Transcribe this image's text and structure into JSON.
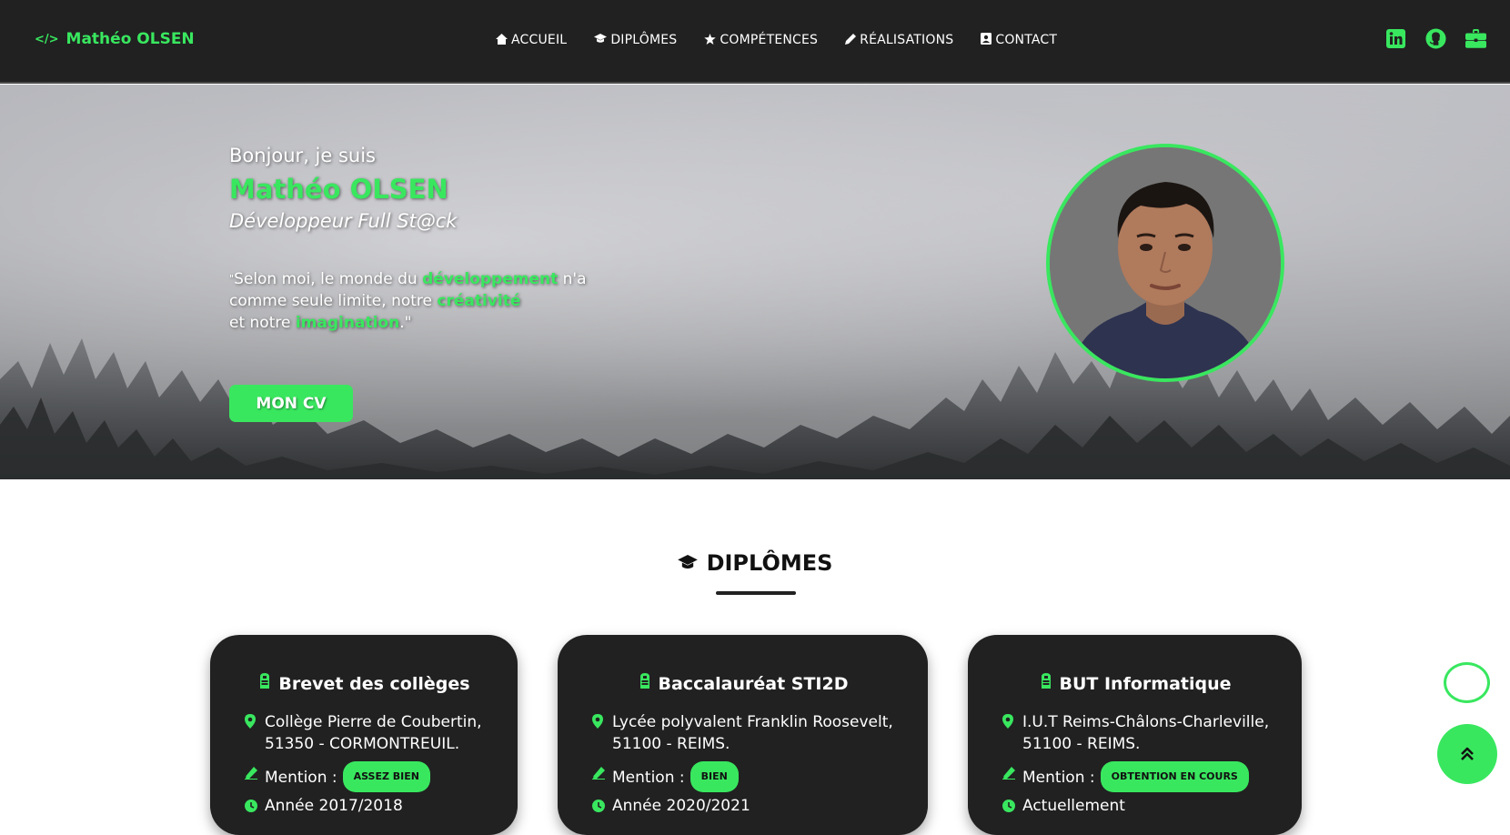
{
  "nav": {
    "brand": "Mathéo OLSEN",
    "links": [
      {
        "icon": "home-icon",
        "label": "ACCUEIL"
      },
      {
        "icon": "graduation-cap-icon",
        "label": "DIPLÔMES"
      },
      {
        "icon": "star-icon",
        "label": "COMPÉTENCES"
      },
      {
        "icon": "pen-icon",
        "label": "RÉALISATIONS"
      },
      {
        "icon": "contact-card-icon",
        "label": "CONTACT"
      }
    ],
    "social": [
      "linkedin-icon",
      "github-icon",
      "briefcase-icon"
    ]
  },
  "hero": {
    "greeting": "Bonjour, je suis",
    "name": "Mathéo OLSEN",
    "role": "Développeur Full St@ck",
    "quote": {
      "open": "\"",
      "p1": "Selon moi, le monde du ",
      "hl1": "développement",
      "p2": " n'a comme seule limite, notre ",
      "hl2": "créativité",
      "p3": " et notre ",
      "hl3": "imagination",
      "close": ".\""
    },
    "cv_button": "MON CV"
  },
  "section": {
    "title": "DIPLÔMES"
  },
  "diplomas": [
    {
      "title": "Brevet des collèges",
      "place_line1": "Collège Pierre de Coubertin,",
      "place_line2": "51350 - CORMONTREUIL.",
      "mention_label": "Mention :",
      "mention": "ASSEZ BIEN",
      "year": "Année 2017/2018"
    },
    {
      "title": "Baccalauréat STI2D",
      "place_line1": "Lycée polyvalent Franklin Roosevelt,",
      "place_line2": "51100 - REIMS.",
      "mention_label": "Mention :",
      "mention": "BIEN",
      "year": "Année 2020/2021"
    },
    {
      "title": "BUT Informatique",
      "place_line1": "I.U.T Reims-Châlons-Charleville,",
      "place_line2": "51100 - REIMS.",
      "mention_label": "Mention :",
      "mention": "OBTENTION EN COURS",
      "year": "Actuellement"
    }
  ],
  "colors": {
    "accent": "#39e75f",
    "navbar": "#212121",
    "card": "#212121"
  }
}
